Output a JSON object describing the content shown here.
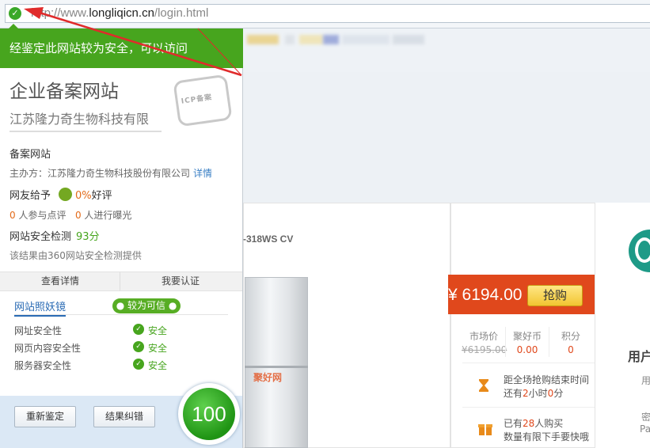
{
  "address_bar": {
    "url_prefix": "http://www.",
    "url_domain": "longliqicn.cn",
    "url_path": "/login.html",
    "shield_icon": "shield-check-icon"
  },
  "popup": {
    "header": "经鉴定此网站较为安全，可以访问",
    "enterprise_title": "企业备案网站",
    "enterprise_name": "江苏隆力奇生物科技有限",
    "seal_text": "ICP备案",
    "record_site_label": "备案网站",
    "organizer_label": "主办方：江苏隆力奇生物科技股份有限公司",
    "organizer_link": "详情",
    "rating_prefix": "网友给予",
    "rating_pct": "0%",
    "rating_suffix": "好评",
    "stats_num1": "0",
    "stats_text1": "人参与点评",
    "stats_num2": "0",
    "stats_text2": "人进行曝光",
    "safety_label": "网站安全检测",
    "safety_score": "93分",
    "safety_note": "该结果由360网站安全检测提供",
    "tabs": [
      "查看详情",
      "我要认证"
    ],
    "mirror_title": "网站照妖镜",
    "trust_badge": "较为可信",
    "checks": [
      {
        "label": "网址安全性",
        "value": "安全"
      },
      {
        "label": "网页内容安全性",
        "value": "安全"
      },
      {
        "label": "服务器安全性",
        "value": "安全"
      }
    ],
    "buttons": [
      "重新鉴定",
      "结果纠错"
    ],
    "score": "100"
  },
  "page": {
    "model_text": "-318WS CV",
    "watermark": "聚好网",
    "price": "¥ 6194.00",
    "buy_label": "抢购",
    "meta_labels": [
      "市场价",
      "聚好币",
      "积分"
    ],
    "meta_values": [
      "¥6195.00",
      "0.00",
      "0"
    ],
    "countdown_line1": "距全场抢购结束时间",
    "countdown_line2_a": "还有",
    "countdown_hours": "2",
    "countdown_line2_b": "小时",
    "countdown_minutes": "0",
    "countdown_line2_c": "分",
    "buyers_line1_a": "已有",
    "buyers_count": "28",
    "buyers_line1_b": "人购买",
    "buyers_line2": "数量有限下手要快哦",
    "right_title": "用户",
    "right_sub": "用",
    "right_sub2": "密",
    "right_sub3": "Pa"
  },
  "colors": {
    "safe_green": "#47a51e",
    "price_red": "#e0481c",
    "link_blue": "#3a7fc4"
  }
}
